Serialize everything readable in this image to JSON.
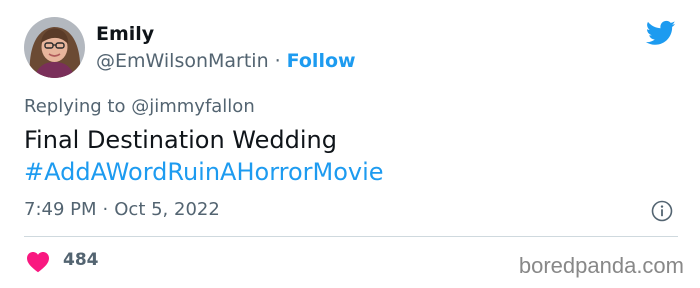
{
  "author": {
    "display_name": "Emily",
    "handle": "@EmWilsonMartin",
    "separator": "·",
    "follow_label": "Follow"
  },
  "reply": {
    "prefix": "Replying to",
    "mention": "@jimmyfallon"
  },
  "tweet": {
    "text": "Final Destination Wedding",
    "hashtag": "#AddAWordRuinAHorrorMovie"
  },
  "meta": {
    "time": "7:49 PM",
    "separator": "·",
    "date": "Oct 5, 2022"
  },
  "engagement": {
    "likes": "484"
  },
  "watermark": "boredpanda.com",
  "icons": {
    "twitter": "twitter-bird-icon",
    "info": "info-icon",
    "like": "heart-icon"
  },
  "colors": {
    "accent": "#1d9bf0",
    "heart": "#f91880",
    "muted_text": "#536471",
    "primary_text": "#0f1419",
    "divider": "#cfd9de"
  }
}
